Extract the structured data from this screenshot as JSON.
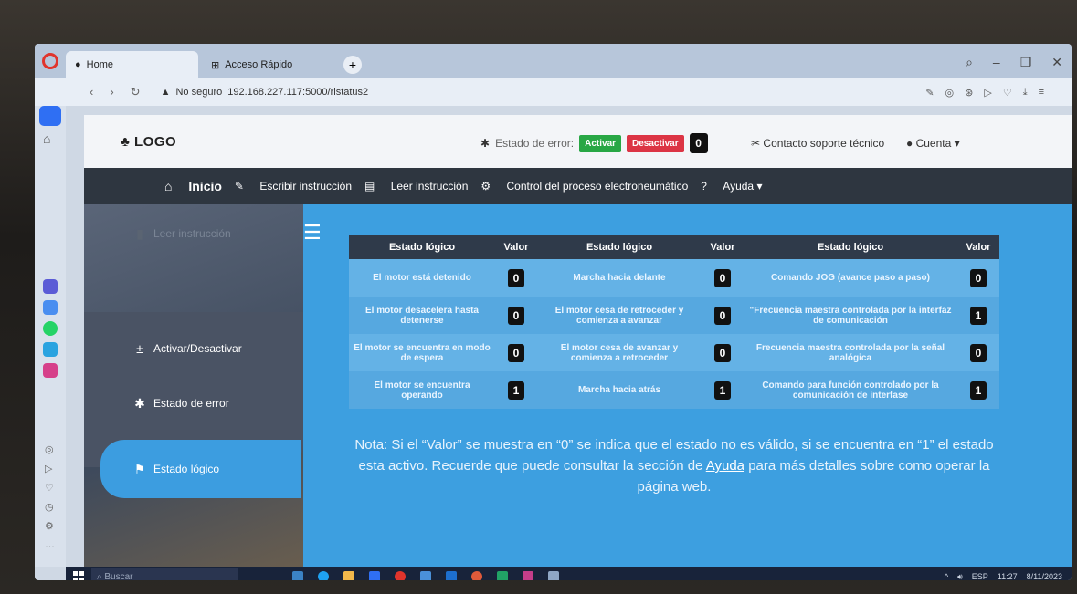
{
  "browser": {
    "tabs": [
      {
        "label": "Home",
        "active": true
      },
      {
        "label": "Acceso Rápido",
        "active": false
      }
    ],
    "new_tab": "+",
    "security_label": "No seguro",
    "url": "192.168.227.117:5000/rlstatus2"
  },
  "header": {
    "logo": "LOGO",
    "error_label": "Estado de error:",
    "activate_label": "Activar",
    "deactivate_label": "Desactivar",
    "error_value": "0",
    "support_label": "Contacto soporte técnico",
    "account_label": "Cuenta"
  },
  "menu": {
    "home": "Inicio",
    "write": "Escribir instrucción",
    "read": "Leer instrucción",
    "control": "Control del proceso electroneumático",
    "help": "Ayuda"
  },
  "sidebar": {
    "items": [
      {
        "label": "Leer instrucción"
      },
      {
        "label": "Activar/Desactivar"
      },
      {
        "label": "Estado de error"
      },
      {
        "label": "Estado lógico"
      }
    ]
  },
  "table": {
    "headers": [
      "Estado lógico",
      "Valor",
      "Estado lógico",
      "Valor",
      "Estado lógico",
      "Valor"
    ],
    "rows": [
      [
        "El motor está detenido",
        "0",
        "Marcha hacia delante",
        "0",
        "Comando JOG (avance paso a paso)",
        "0"
      ],
      [
        "El motor desacelera hasta detenerse",
        "0",
        "El motor cesa de retroceder y comienza a avanzar",
        "0",
        "\"Frecuencia maestra controlada por la interfaz de comunicación",
        "1"
      ],
      [
        "El motor se encuentra en modo de espera",
        "0",
        "El motor cesa de avanzar y comienza a retroceder",
        "0",
        "Frecuencia maestra controlada por la señal analógica",
        "0"
      ],
      [
        "El motor se encuentra operando",
        "1",
        "Marcha hacia atrás",
        "1",
        "Comando para función controlado por la comunicación de interfase",
        "1"
      ]
    ]
  },
  "note": {
    "text_before": "Nota: Si el “Valor” se muestra en “0” se indica que el estado no es válido, si se encuentra en “1” el estado esta activo. Recuerde que puede consultar la sección de",
    "link": "Ayuda",
    "text_after": "para más detalles sobre como operar la página web."
  },
  "taskbar": {
    "search_placeholder": "Buscar",
    "lang": "ESP",
    "time": "11:27",
    "date": "8/11/2023"
  },
  "colors": {
    "accent": "#3c9de0",
    "activate": "#28a745",
    "deactivate": "#dc3545",
    "menubar": "#2e3640"
  }
}
